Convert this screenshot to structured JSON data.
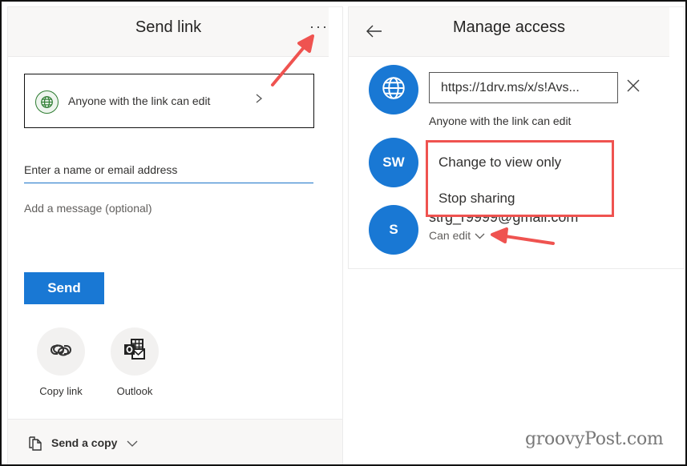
{
  "send_link_panel": {
    "title": "Send link",
    "more_options_icon": "ellipsis-icon",
    "link_setting": {
      "icon": "globe-icon",
      "label": "Anyone with the link can edit",
      "chevron_icon": "chevron-right-icon"
    },
    "recipient_input": {
      "placeholder": "Enter a name or email address",
      "value": ""
    },
    "message_input": {
      "placeholder": "Add a message (optional)",
      "value": ""
    },
    "send_button_label": "Send",
    "share_options": [
      {
        "label": "Copy link",
        "icon": "link-icon"
      },
      {
        "label": "Outlook",
        "icon": "outlook-icon"
      }
    ],
    "footer": {
      "icon": "copy-document-icon",
      "label": "Send a copy",
      "chevron_icon": "chevron-down-icon"
    }
  },
  "manage_access_panel": {
    "title": "Manage access",
    "back_icon": "arrow-left-icon",
    "link_entry": {
      "avatar_icon": "globe-icon",
      "url": "https://1drv.ms/x/s!Avs...",
      "permission": "Anyone with the link can edit",
      "remove_icon": "close-icon"
    },
    "people": [
      {
        "initials": "SW"
      },
      {
        "initials": "S",
        "email": "strg_r9999@gmail.com",
        "permission": "Can edit"
      }
    ],
    "context_menu": {
      "items": [
        "Change to view only",
        "Stop sharing"
      ]
    }
  },
  "annotations": {
    "highlight_color": "#ef5350"
  },
  "colors": {
    "accent": "#1978d4",
    "header_bg": "#f8f7f6",
    "highlight": "#ef5350"
  },
  "watermark": "groovyPost.com"
}
